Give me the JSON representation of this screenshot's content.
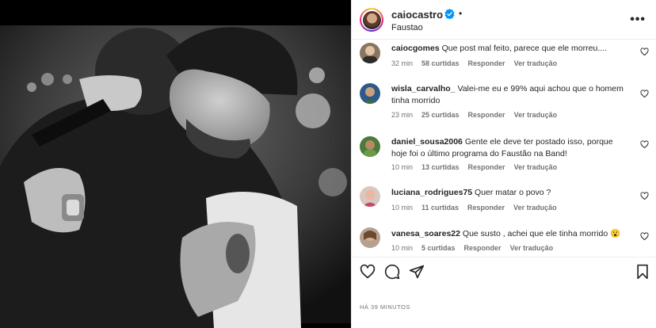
{
  "header": {
    "username": "caiocastro",
    "subtitle": "Faustao",
    "dot": "•",
    "more": "•••"
  },
  "comments": [
    {
      "user": "caiocgomes",
      "text": "Que post mal feito, parece que ele morreu....",
      "time": "32 min",
      "likes": "58 curtidas",
      "reply": "Responder",
      "translate": "Ver tradução"
    },
    {
      "user": "wisla_carvalho_",
      "text": "Valei-me eu e 99% aqui achou que o homem tinha morrido",
      "time": "23 min",
      "likes": "25 curtidas",
      "reply": "Responder",
      "translate": "Ver tradução"
    },
    {
      "user": "daniel_sousa2006",
      "text": "Gente ele deve ter postado isso, porque hoje foi o último programa do Faustão na Band!",
      "time": "10 min",
      "likes": "13 curtidas",
      "reply": "Responder",
      "translate": "Ver tradução"
    },
    {
      "user": "luciana_rodrigues75",
      "text": "Quer matar o povo ?",
      "time": "10 min",
      "likes": "11 curtidas",
      "reply": "Responder",
      "translate": "Ver tradução"
    },
    {
      "user": "vanesa_soares22",
      "text": "Que susto , achei que ele tinha morrido 😮",
      "time": "10 min",
      "likes": "5 curtidas",
      "reply": "Responder",
      "translate": "Ver tradução"
    }
  ],
  "footer": {
    "posted_time": "HÁ 39 MINUTOS"
  },
  "colors": {
    "verified": "#0095f6",
    "text": "#262626",
    "secondary": "#737373"
  }
}
